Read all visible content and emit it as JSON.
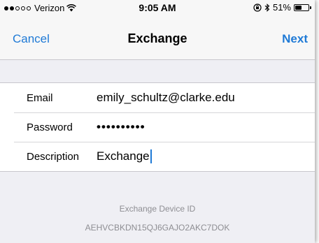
{
  "status_bar": {
    "carrier": "Verizon",
    "time": "9:05 AM",
    "battery": "51%",
    "battery_level": 0.51,
    "signal_bars_filled": 2,
    "signal_bars_total": 5
  },
  "nav": {
    "cancel_label": "Cancel",
    "title": "Exchange",
    "next_label": "Next"
  },
  "form": {
    "email_label": "Email",
    "email_value": "emily_schultz@clarke.edu",
    "password_label": "Password",
    "password_value": "••••••••••",
    "description_label": "Description",
    "description_value": "Exchange"
  },
  "footer": {
    "device_id_label": "Exchange Device ID",
    "device_id": "AEHVCBKDN15QJ6GAJO2AKC7DOK"
  },
  "colors": {
    "accent": "#1f7ad6",
    "background": "#efeff4",
    "secondary_text": "#8e8e93"
  }
}
